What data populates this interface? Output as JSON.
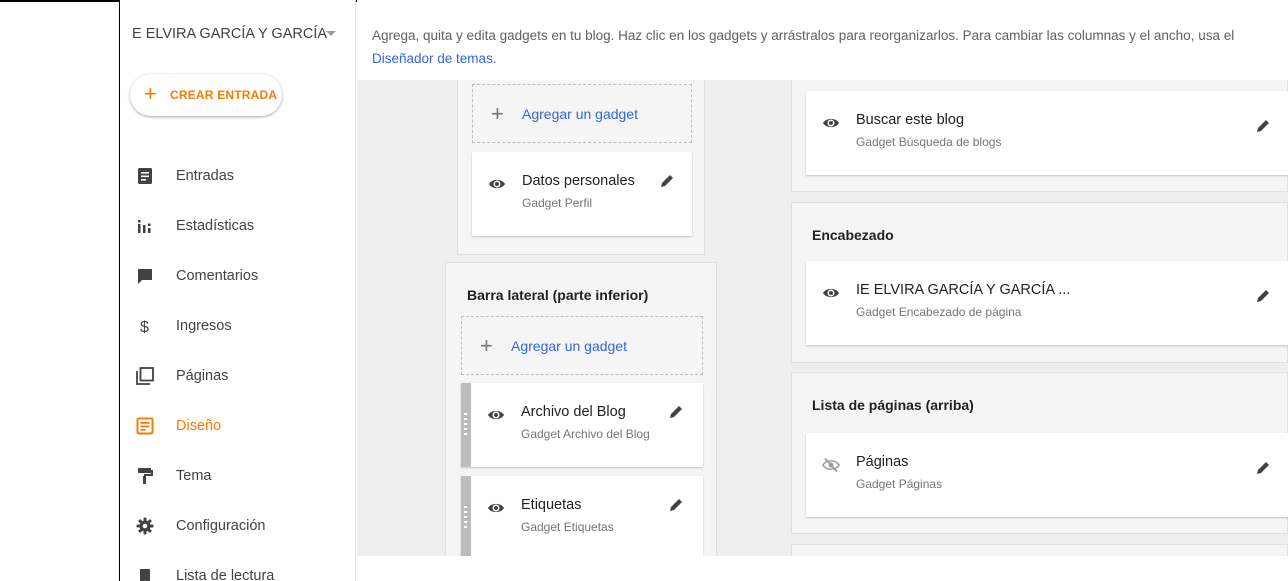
{
  "sidebar": {
    "blog_title": "E ELVIRA GARCÍA Y GARCÍA",
    "create_label": "CREAR ENTRADA",
    "items": [
      {
        "label": "Entradas",
        "icon": "posts-icon"
      },
      {
        "label": "Estadísticas",
        "icon": "stats-icon"
      },
      {
        "label": "Comentarios",
        "icon": "comments-icon"
      },
      {
        "label": "Ingresos",
        "icon": "dollar-icon"
      },
      {
        "label": "Páginas",
        "icon": "pages-icon"
      },
      {
        "label": "Diseño",
        "icon": "layout-icon",
        "active": true
      },
      {
        "label": "Tema",
        "icon": "theme-roller-icon"
      },
      {
        "label": "Configuración",
        "icon": "gear-icon"
      },
      {
        "label": "Lista de lectura",
        "icon": "reading-list-icon"
      }
    ]
  },
  "main": {
    "intro_text": "Agrega, quita y edita gadgets en tu blog. Haz clic en los gadgets y arrástralos para reorganizarlos. Para cambiar las columnas y el ancho, usa el",
    "intro_link": "Diseñador de temas.",
    "left_top": {
      "add_label": "Agregar un gadget",
      "card": {
        "title": "Datos personales",
        "subtitle": "Gadget Perfil"
      }
    },
    "sidebar_bottom": {
      "title": "Barra lateral (parte inferior)",
      "add_label": "Agregar un gadget",
      "cards": [
        {
          "title": "Archivo del Blog",
          "subtitle": "Gadget Archivo del Blog"
        },
        {
          "title": "Etiquetas",
          "subtitle": "Gadget Etiquetas"
        }
      ]
    },
    "right_top": {
      "card": {
        "title": "Buscar este blog",
        "subtitle": "Gadget Búsqueda de blogs"
      }
    },
    "header_section": {
      "title": "Encabezado",
      "card": {
        "title": "IE ELVIRA GARCÍA Y GARCÍA ...",
        "subtitle": "Gadget Encabezado de página"
      }
    },
    "pages_section": {
      "title": "Lista de páginas (arriba)",
      "card": {
        "title": "Páginas",
        "subtitle": "Gadget Páginas"
      }
    }
  },
  "colors": {
    "accent": "#f57c00",
    "link": "#3367d6",
    "canvas": "#eeeeee"
  }
}
